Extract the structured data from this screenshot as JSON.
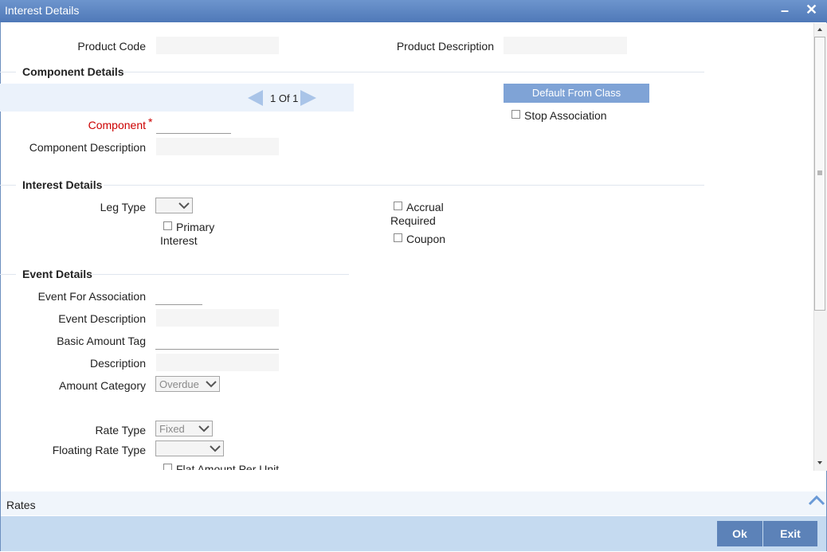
{
  "window": {
    "title": "Interest Details",
    "minimize_symbol": "–",
    "close_symbol": "✕"
  },
  "header_fields": {
    "product_code_label": "Product Code",
    "product_code_value": "",
    "product_description_label": "Product Description",
    "product_description_value": ""
  },
  "component_details": {
    "title": "Component Details",
    "pager_text": "1 Of 1",
    "default_from_class_label": "Default From Class",
    "stop_association_label": "Stop Association",
    "component_label": "Component",
    "required_mark": "*",
    "component_value": "",
    "component_description_label": "Component Description",
    "component_description_value": ""
  },
  "interest_details": {
    "title": "Interest Details",
    "leg_type_label": "Leg Type",
    "leg_type_value": "",
    "primary_interest_label_1": "Primary",
    "primary_interest_label_2": "Interest",
    "accrual_required_label_1": "Accrual",
    "accrual_required_label_2": "Required",
    "coupon_label": "Coupon"
  },
  "event_details": {
    "title": "Event Details",
    "event_for_association_label": "Event For Association",
    "event_description_label": "Event Description",
    "basic_amount_tag_label": "Basic Amount Tag",
    "description_label": "Description",
    "amount_category_label": "Amount Category",
    "amount_category_value": "Overdue",
    "rate_type_label": "Rate Type",
    "rate_type_value": "Fixed",
    "floating_rate_type_label": "Floating Rate Type",
    "floating_rate_type_value": "",
    "flat_amount_per_unit_label": "Flat Amount Per Unit"
  },
  "rates_bar": {
    "label": "Rates"
  },
  "footer": {
    "ok_label": "Ok",
    "exit_label": "Exit"
  }
}
